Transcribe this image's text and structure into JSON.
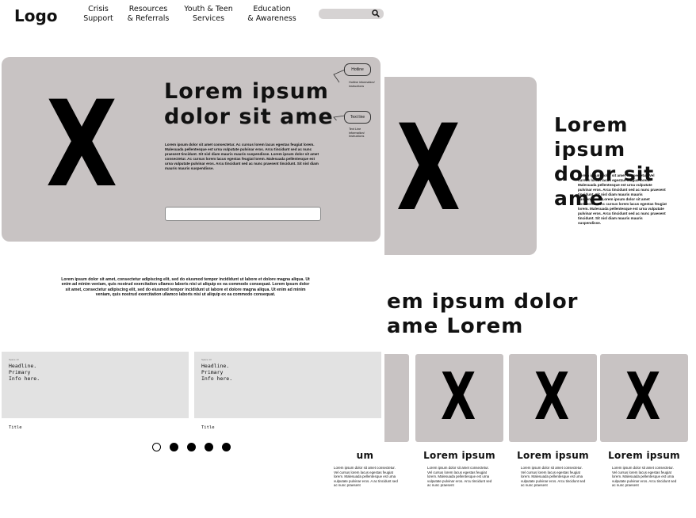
{
  "header": {
    "logo": "Logo",
    "nav": [
      {
        "line1": "Crisis",
        "line2": "Support"
      },
      {
        "line1": "Resources",
        "line2": "& Referrals"
      },
      {
        "line1": "Youth & Teen",
        "line2": "Services"
      },
      {
        "line1": "Education",
        "line2": "& Awareness"
      }
    ],
    "search": {
      "placeholder": "",
      "icon": "search-icon"
    }
  },
  "hero": {
    "placeholder": "X",
    "title_line1": "Lorem ipsum",
    "title_line2": "dolor sit ame",
    "body": "Lorem ipsum dolor sit amet consectetur. Ac cursus lorem lacus egestas feugiat lorem. Malesuada pellentesque est urna vulputate pulvinar eros. Arcu tincidunt sed ac nunc praesent tincidunt. Sit nisl diam mauris mauris suspendisse. Lorem ipsum dolor sit amet consectetur. Ac cursus lorem lacus egestas feugiat lorem. Malesuada pellentesque est urna vulputate pulvinar eros. Arcu tincidunt sed ac nunc praesent tincidunt. Sit nisl diam mauris mauris suspendisse.",
    "input_value": "",
    "tooltips": [
      {
        "label": "Hotline",
        "text": "Hotline information/ instructions"
      },
      {
        "label": "Text line",
        "text": "Text Line information/ Instructions"
      }
    ]
  },
  "second_hero": {
    "placeholder": "X",
    "title_line1": "Lorem ipsum",
    "title_line2": "dolor sit",
    "title_line3": "ame",
    "body": "Lorem ipsum dolor sit amet consectetur. Vel cursus lorem lacus egestas feugiat lorem. Malesuada pellentesque est urna vulputate pulvinar eros. Arcu tincidunt sed ac nunc praesent tincidunt. Sit nisl diam mauris mauris suspendisse. Lorem ipsum dolor sit amet consectetur. Ac cursus lorem lacus egestas feugiat lorem. Malesuada pellentesque est urna vulputate pulvinar eros. Arcu tincidunt sed ac nunc praesent tincidunt. Sit nisl diam mauris mauris suspendisse."
  },
  "intro_paragraph": "Lorem ipsum dolor sit amet, consectetur adipiscing elit, sed do eiusmod tempor incididunt ut labore et dolore magna aliqua. Ut enim ad minim veniam, quis nostrud exercitation ullamco laboris nisi ut aliquip ex ea commodo consequat. Lorem ipsum dolor sit amet, consectetur adipiscing elit, sed do eiusmod tempor incididunt ut labore et dolore magna aliqua. Ut enim ad minim veniam, quis nostrud exercitation ullamco laboris nisi ut aliquip ex ea commodo consequat.",
  "features": [
    {
      "small": "Space 13",
      "line1": "Headline.",
      "line2": "Primary",
      "line3": "Info here.",
      "title": "Title"
    },
    {
      "small": "Space 13",
      "line1": "Headline.",
      "line2": "Primary",
      "line3": "Info here.",
      "title": "Title"
    }
  ],
  "carousel": {
    "total": 5,
    "active_index": 0
  },
  "section": {
    "title_line1": "em ipsum dolor",
    "title_line2": "ame Lorem"
  },
  "tiles": [
    {
      "placeholder": "",
      "title": "um",
      "body": "Lorem ipsum dolor sit amet consectetur. Vel cursus lorem lacus egestas feugiat lorem. Malesuada pellentesque est urna vulputate pulvinar eros. A ac tincidunt sed ac nunc praesent"
    },
    {
      "placeholder": "X",
      "title": "Lorem ipsum",
      "body": "Lorem ipsum dolor sit amet consectetur. Vel cursus lorem lacus egestas feugiat lorem. Malesuada pellentesque est urna vulputate pulvinar eros. Arcu tincidunt sed ac nunc praesent"
    },
    {
      "placeholder": "X",
      "title": "Lorem ipsum",
      "body": "Lorem ipsum dolor sit amet consectetur. Vel cursus lorem lacus egestas feugiat lorem. Malesuada pellentesque est urna vulputate pulvinar eros. Arcu tincidunt sed ac nunc praesent"
    },
    {
      "placeholder": "X",
      "title": "Lorem ipsum",
      "body": "Lorem ipsum dolor sit amet consectetur. Vel cursus lorem lacus egestas feugiat lorem. Malesuada pellentesque est urna vulputate pulvinar eros. Arcu tincidunt sed ac nunc praesent"
    }
  ],
  "colors": {
    "card_gray": "#c8c3c3",
    "light_gray": "#e2e2e2",
    "search_gray": "#d6d3d3"
  }
}
